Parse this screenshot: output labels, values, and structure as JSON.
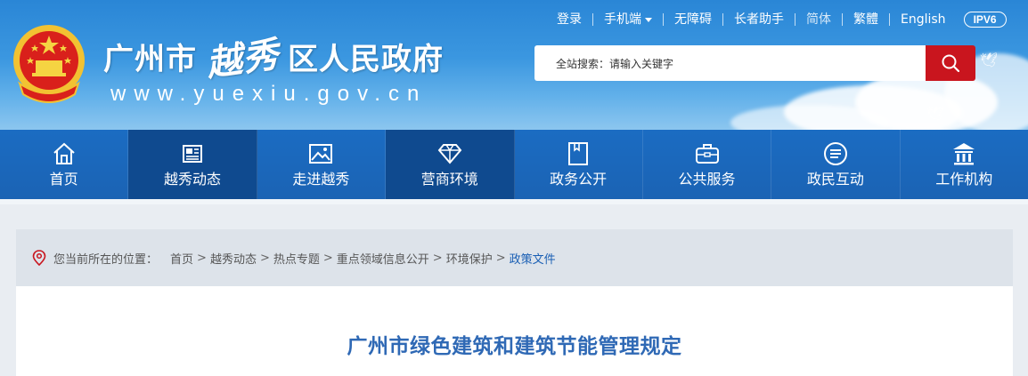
{
  "header": {
    "site_title_prefix": "广州市",
    "site_title_callig": "越秀",
    "site_title_suffix": "区人民政府",
    "domain": "www.yuexiu.gov.cn",
    "emblem_icon": "national-emblem-icon"
  },
  "topnav": {
    "items": [
      "登录",
      "手机端",
      "无障碍",
      "长者助手",
      "简体",
      "繁體",
      "English"
    ],
    "ipv6_badge": "IPV6"
  },
  "search": {
    "placeholder": "全站搜索：请输入关键字",
    "button_icon": "search-icon",
    "button_color": "#c9151e"
  },
  "mainnav": {
    "items": [
      {
        "label": "首页",
        "icon": "home-icon",
        "active": false
      },
      {
        "label": "越秀动态",
        "icon": "newspaper-icon",
        "active": true
      },
      {
        "label": "走进越秀",
        "icon": "picture-icon",
        "active": false
      },
      {
        "label": "营商环境",
        "icon": "diamond-icon",
        "active": true
      },
      {
        "label": "政务公开",
        "icon": "document-icon",
        "active": false
      },
      {
        "label": "公共服务",
        "icon": "toolbox-icon",
        "active": false
      },
      {
        "label": "政民互动",
        "icon": "chat-icon",
        "active": false
      },
      {
        "label": "工作机构",
        "icon": "institution-icon",
        "active": false
      }
    ]
  },
  "breadcrumb": {
    "lead": "您当前所在的位置：",
    "items": [
      "首页",
      "越秀动态",
      "热点专题",
      "重点领域信息公开",
      "环境保护",
      "政策文件"
    ]
  },
  "article": {
    "title": "广州市绿色建筑和建筑节能管理规定"
  },
  "colors": {
    "nav_blue": "#1b6cc2",
    "nav_active": "#0f4a8f",
    "title_blue": "#2f69b5",
    "accent_red": "#c9151e"
  }
}
